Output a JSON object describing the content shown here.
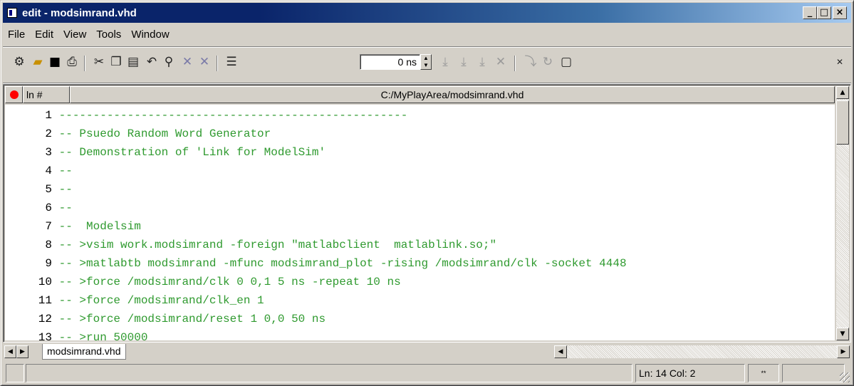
{
  "window": {
    "title": "edit - modsimrand.vhd",
    "controls": {
      "minimize": "_",
      "restore": "□",
      "close": "×"
    }
  },
  "menu": [
    "File",
    "Edit",
    "View",
    "Tools",
    "Window"
  ],
  "toolbar": {
    "icons": [
      "compile-icon",
      "open-icon",
      "save-icon",
      "print-icon",
      "cut-icon",
      "copy-icon",
      "paste-icon",
      "undo-icon",
      "find-icon",
      "clear-marker-icon",
      "delete-marker-icon",
      "source-icon",
      "step-icon",
      "step-over-icon",
      "step-out-icon",
      "break-icon",
      "continue-icon",
      "restart-icon",
      "document-icon"
    ],
    "time_value": "0 ns"
  },
  "editor": {
    "header": {
      "ln_label": "ln #",
      "file_path": "C:/MyPlayArea/modsimrand.vhd"
    },
    "lines": [
      {
        "num": "1",
        "text": "---------------------------------------------------"
      },
      {
        "num": "2",
        "text": "-- Psuedo Random Word Generator"
      },
      {
        "num": "3",
        "text": "-- Demonstration of 'Link for ModelSim'"
      },
      {
        "num": "4",
        "text": "--"
      },
      {
        "num": "5",
        "text": "--"
      },
      {
        "num": "6",
        "text": "--"
      },
      {
        "num": "7",
        "text": "--  Modelsim"
      },
      {
        "num": "8",
        "text": "-- >vsim work.modsimrand -foreign \"matlabclient  matlablink.so;\""
      },
      {
        "num": "9",
        "text": "-- >matlabtb modsimrand -mfunc modsimrand_plot -rising /modsimrand/clk -socket 4448"
      },
      {
        "num": "10",
        "text": "-- >force /modsimrand/clk 0 0,1 5 ns -repeat 10 ns"
      },
      {
        "num": "11",
        "text": "-- >force /modsimrand/clk_en 1"
      },
      {
        "num": "12",
        "text": "-- >force /modsimrand/reset 1 0,0 50 ns"
      },
      {
        "num": "13",
        "text": "-- >run 50000"
      }
    ]
  },
  "tabs": [
    {
      "label": "modsimrand.vhd"
    }
  ],
  "status": {
    "position": "Ln:  14 Col: 2",
    "mode": "**"
  },
  "colors": {
    "code": "#2f9a2f",
    "title_bar": "#0a246a",
    "breakpoint": "#ff0000"
  }
}
